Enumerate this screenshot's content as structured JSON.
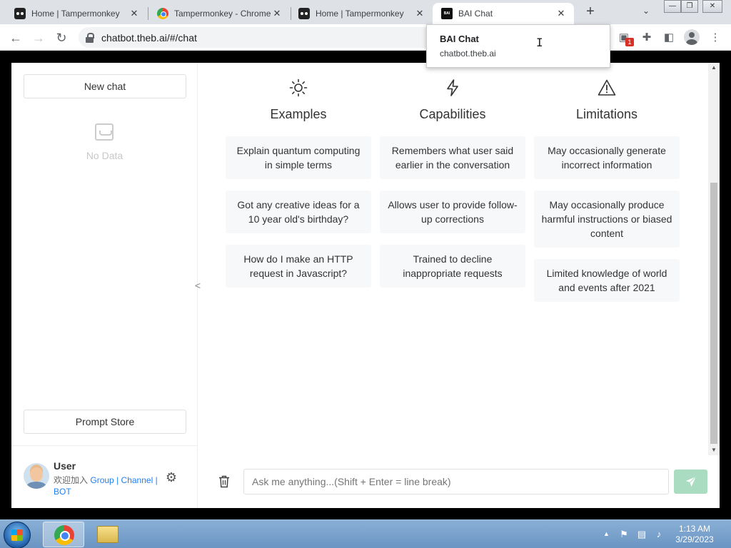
{
  "browser": {
    "tabs": [
      {
        "title": "Home | Tampermonkey",
        "favicon": "tampermonkey-icon",
        "active": false
      },
      {
        "title": "Tampermonkey - Chrome",
        "favicon": "chrome-webstore-icon",
        "active": false
      },
      {
        "title": "Home | Tampermonkey",
        "favicon": "tampermonkey-icon",
        "active": false
      },
      {
        "title": "BAI Chat",
        "favicon": "bai-icon",
        "active": true
      }
    ],
    "url": "chatbot.theb.ai/#/chat",
    "extension_badge": "1",
    "hover_card": {
      "title": "BAI Chat",
      "url": "chatbot.theb.ai"
    }
  },
  "sidebar": {
    "new_chat_label": "New chat",
    "empty_text": "No Data",
    "prompt_store_label": "Prompt Store",
    "user": {
      "name": "User",
      "join_prefix": "欢迎加入",
      "links": [
        "Group",
        "Channel",
        "BOT"
      ],
      "separator": "|"
    }
  },
  "main": {
    "columns": [
      {
        "title": "Examples",
        "icon": "sun-icon",
        "cards": [
          "Explain quantum computing in simple terms",
          "Got any creative ideas for a 10 year old's birthday?",
          "How do I make an HTTP request in Javascript?"
        ]
      },
      {
        "title": "Capabilities",
        "icon": "lightning-icon",
        "cards": [
          "Remembers what user said earlier in the conversation",
          "Allows user to provide follow-up corrections",
          "Trained to decline inappropriate requests"
        ]
      },
      {
        "title": "Limitations",
        "icon": "warning-icon",
        "cards": [
          "May occasionally generate incorrect information",
          "May occasionally produce harmful instructions or biased content",
          "Limited knowledge of world and events after 2021"
        ]
      }
    ],
    "input_placeholder": "Ask me anything...(Shift + Enter = line break)"
  },
  "taskbar": {
    "time": "1:13 AM",
    "date": "3/29/2023"
  },
  "colors": {
    "send_button": "#a9dcc0",
    "link": "#2080f0",
    "card_bg": "#f7f8fa"
  }
}
